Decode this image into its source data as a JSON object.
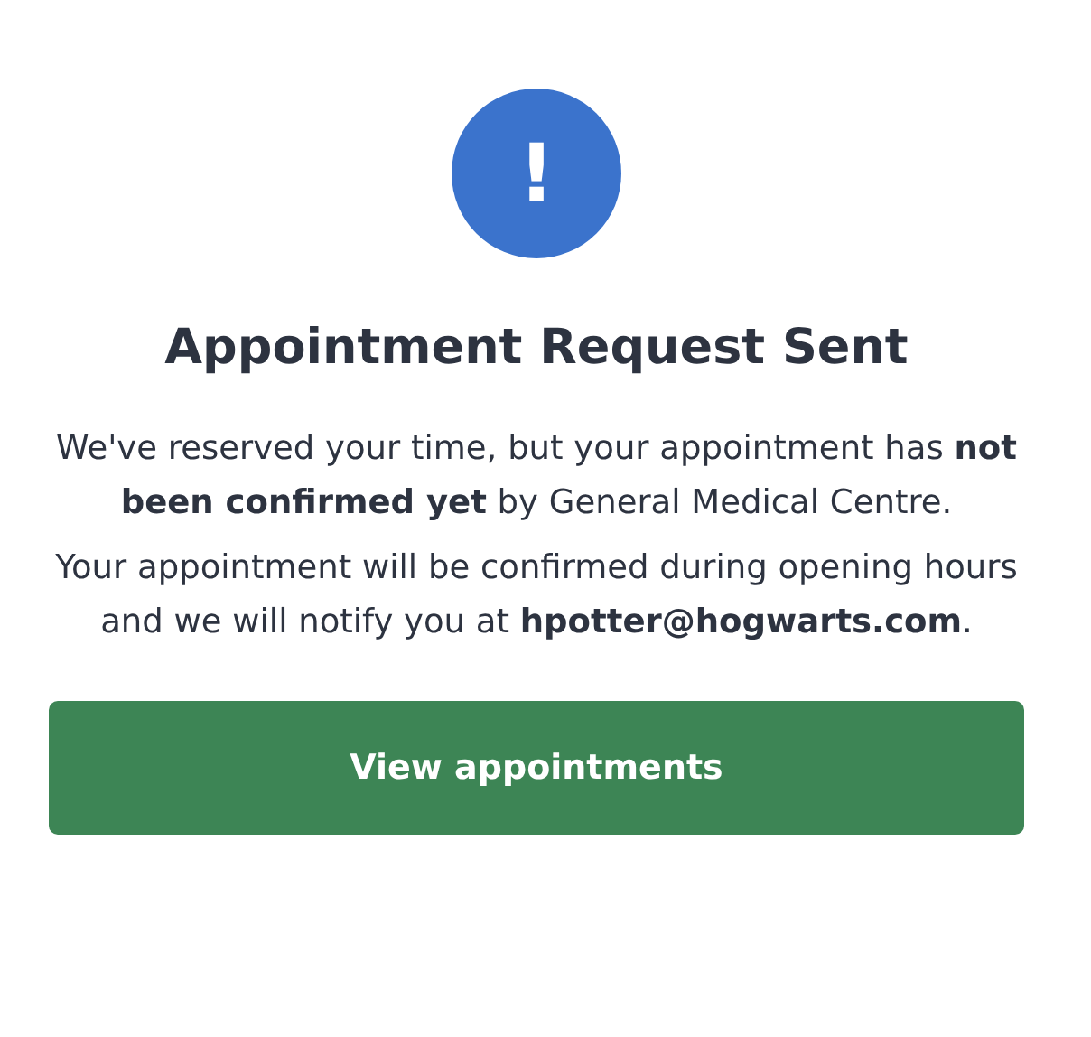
{
  "title": "Appointment Request Sent",
  "paragraphs": [
    "We've reserved your time, but your appointment has **not been confirmed yet** by General Medical Centre.",
    "Your appointment will be confirmed during opening hours and we will notify you at **hpotter@hogwarts.com**."
  ],
  "icon": {
    "glyph": "!"
  },
  "button": {
    "label": "View appointments"
  }
}
